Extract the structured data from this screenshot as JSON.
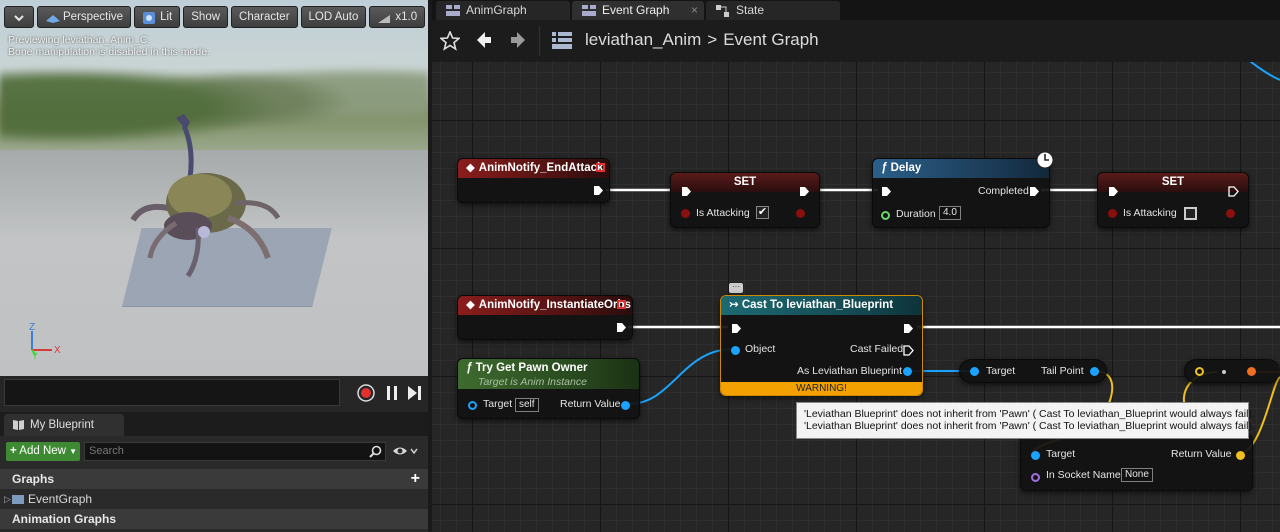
{
  "viewport": {
    "toolbar": {
      "perspective": "Perspective",
      "lit": "Lit",
      "show": "Show",
      "character": "Character",
      "lod": "LOD Auto",
      "speed": "x1.0"
    },
    "note_line1": "Previewing leviathan_Anim_C.",
    "note_line2": "Bone manipulation is disabled in this mode.",
    "axis": {
      "z": "Z",
      "y": "Y",
      "x": "X"
    }
  },
  "my_blueprint": {
    "tab_label": "My Blueprint",
    "add_new": "Add New",
    "search_placeholder": "Search",
    "graphs_header": "Graphs",
    "event_graph_item": "EventGraph",
    "anim_graphs_header": "Animation Graphs"
  },
  "graph": {
    "tabs": [
      {
        "label": "AnimGraph"
      },
      {
        "label": "Event Graph"
      },
      {
        "label": "State"
      }
    ],
    "close_glyph": "×",
    "breadcrumb": {
      "root": "leviathan_Anim",
      "separator": ">",
      "current": "Event Graph"
    },
    "nodes": {
      "notify_end": {
        "title": "AnimNotify_EndAttack"
      },
      "set1": {
        "title": "SET",
        "pin": "Is Attacking",
        "checked": true
      },
      "delay": {
        "title": "Delay",
        "completed": "Completed",
        "duration_label": "Duration",
        "duration_value": "4.0"
      },
      "set2": {
        "title": "SET",
        "pin": "Is Attacking",
        "checked": false
      },
      "notify_orbs": {
        "title": "AnimNotify_InstantiateOrbs"
      },
      "cast": {
        "title": "Cast To leviathan_Blueprint",
        "object": "Object",
        "cast_failed": "Cast Failed",
        "as_bp": "As Leviathan Blueprint",
        "warning": "WARNING!"
      },
      "pawn_owner": {
        "title": "Try Get Pawn Owner",
        "subtitle": "Target is Anim Instance",
        "target": "Target",
        "target_value": "self",
        "return_value": "Return Value"
      },
      "tail_point": {
        "target": "Target",
        "output": "Tail Point"
      },
      "socket": {
        "target": "Target",
        "socket_name": "In Socket Name",
        "socket_value": "None",
        "return_value": "Return Value"
      }
    },
    "tooltip": {
      "line1": "'Leviathan Blueprint' does not inherit from 'Pawn' ( Cast To leviathan_Blueprint  would always fail).",
      "line2": "'Leviathan Blueprint' does not inherit from 'Pawn' ( Cast To leviathan_Blueprint  would always fail)."
    },
    "colors": {
      "exec": "#ffffff",
      "bool": "#8a0f0f",
      "object": "#1aa3ff",
      "float": "#6bd66b",
      "vector": "#f0c020",
      "name": "#a070e0",
      "warning": "#f2a100"
    }
  }
}
